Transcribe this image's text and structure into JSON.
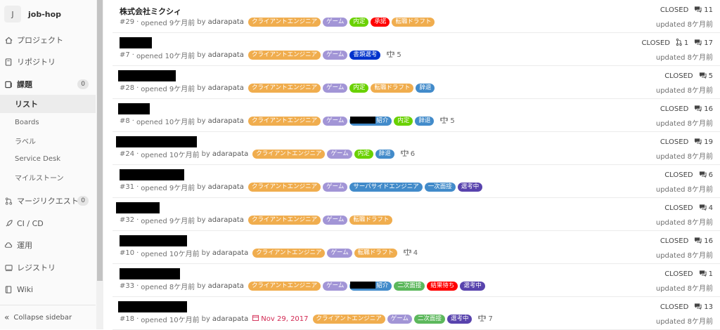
{
  "sidebar": {
    "project_initial": "J",
    "project_name": "job-hop",
    "items": [
      {
        "label": "プロジェクト",
        "icon": "home-icon"
      },
      {
        "label": "リポジトリ",
        "icon": "repository-icon"
      },
      {
        "label": "課題",
        "icon": "issues-icon",
        "count": "0"
      },
      {
        "label": "マージリクエスト",
        "icon": "merge-request-icon",
        "count": "0"
      },
      {
        "label": "CI / CD",
        "icon": "rocket-icon"
      },
      {
        "label": "運用",
        "icon": "cloud-icon"
      },
      {
        "label": "レジストリ",
        "icon": "registry-icon"
      },
      {
        "label": "Wiki",
        "icon": "book-icon"
      }
    ],
    "sub_items": [
      "リスト",
      "Boards",
      "ラベル",
      "Service Desk",
      "マイルストーン"
    ],
    "collapse_label": "Collapse sidebar"
  },
  "colors": {
    "client": "#f0ad4e",
    "game": "#a295d6",
    "naitei": "#69d100",
    "shodaku": "#ff0000",
    "tenshoku": "#f0ad4e",
    "shorui": "#0033cc",
    "jitai": "#428bca",
    "server": "#428bca",
    "ichiji": "#428bca",
    "senkouchu": "#5843ad",
    "shoukai": "#428bca",
    "niji": "#5cb85c",
    "kekka": "#ff0000"
  },
  "issues": [
    {
      "title": "株式会社ミクシィ",
      "ref": "#29",
      "opened": "opened 9ケ月前",
      "by": "by",
      "author": "adarapata",
      "labels": [
        {
          "text": "クライアントエンジニア",
          "c": "client"
        },
        {
          "text": "ゲーム",
          "c": "game"
        },
        {
          "text": "内定",
          "c": "naitei"
        },
        {
          "text": "承諾",
          "c": "shodaku"
        },
        {
          "text": "転職ドラフト",
          "c": "tenshoku"
        }
      ],
      "status": "CLOSED",
      "comments": "11",
      "updated": "updated 8ケ月前"
    },
    {
      "ref": "#7",
      "opened": "opened 10ケ月前",
      "by": "by",
      "author": "adarapata",
      "labels": [
        {
          "text": "クライアントエンジニア",
          "c": "client"
        },
        {
          "text": "ゲーム",
          "c": "game"
        },
        {
          "text": "書類選考",
          "c": "shorui"
        }
      ],
      "weight": "5",
      "status": "CLOSED",
      "mr": "1",
      "comments": "17",
      "updated": "updated 8ケ月前"
    },
    {
      "ref": "#28",
      "opened": "opened 9ケ月前",
      "by": "by",
      "author": "adarapata",
      "labels": [
        {
          "text": "クライアントエンジニア",
          "c": "client"
        },
        {
          "text": "ゲーム",
          "c": "game"
        },
        {
          "text": "内定",
          "c": "naitei"
        },
        {
          "text": "転職ドラフト",
          "c": "tenshoku"
        },
        {
          "text": "辞退",
          "c": "jitai"
        }
      ],
      "status": "CLOSED",
      "comments": "5",
      "updated": "updated 8ケ月前"
    },
    {
      "ref": "#8",
      "opened": "opened 10ケ月前",
      "by": "by",
      "author": "adarapata",
      "labels": [
        {
          "text": "クライアントエンジニア",
          "c": "client"
        },
        {
          "text": "ゲーム",
          "c": "game"
        },
        {
          "text": "紹介",
          "c": "shoukai",
          "redacted": true
        },
        {
          "text": "内定",
          "c": "naitei"
        },
        {
          "text": "辞退",
          "c": "jitai"
        }
      ],
      "weight": "5",
      "status": "CLOSED",
      "comments": "16",
      "updated": "updated 8ケ月前"
    },
    {
      "ref": "#24",
      "opened": "opened 10ケ月前",
      "by": "by",
      "author": "adarapata",
      "labels": [
        {
          "text": "クライアントエンジニア",
          "c": "client"
        },
        {
          "text": "ゲーム",
          "c": "game"
        },
        {
          "text": "内定",
          "c": "naitei"
        },
        {
          "text": "辞退",
          "c": "jitai"
        }
      ],
      "weight": "6",
      "status": "CLOSED",
      "comments": "19",
      "updated": "updated 8ケ月前"
    },
    {
      "ref": "#31",
      "opened": "opened 9ケ月前",
      "by": "by",
      "author": "adarapata",
      "labels": [
        {
          "text": "クライアントエンジニア",
          "c": "client"
        },
        {
          "text": "ゲーム",
          "c": "game"
        },
        {
          "text": "サーバサイドエンジニア",
          "c": "server"
        },
        {
          "text": "一次面接",
          "c": "ichiji"
        },
        {
          "text": "選考中",
          "c": "senkouchu"
        }
      ],
      "status": "CLOSED",
      "comments": "6",
      "updated": "updated 8ケ月前"
    },
    {
      "ref": "#32",
      "opened": "opened 9ケ月前",
      "by": "by",
      "author": "adarapata",
      "labels": [
        {
          "text": "クライアントエンジニア",
          "c": "client"
        },
        {
          "text": "ゲーム",
          "c": "game"
        },
        {
          "text": "転職ドラフト",
          "c": "tenshoku"
        }
      ],
      "status": "CLOSED",
      "comments": "4",
      "updated": "updated 8ケ月前"
    },
    {
      "ref": "#10",
      "opened": "opened 10ケ月前",
      "by": "by",
      "author": "adarapata",
      "labels": [
        {
          "text": "クライアントエンジニア",
          "c": "client"
        },
        {
          "text": "ゲーム",
          "c": "game"
        },
        {
          "text": "転職ドラフト",
          "c": "tenshoku"
        }
      ],
      "weight": "4",
      "status": "CLOSED",
      "comments": "16",
      "updated": "updated 8ケ月前"
    },
    {
      "ref": "#33",
      "opened": "opened 8ケ月前",
      "by": "by",
      "author": "adarapata",
      "labels": [
        {
          "text": "クライアントエンジニア",
          "c": "client"
        },
        {
          "text": "ゲーム",
          "c": "game"
        },
        {
          "text": "紹介",
          "c": "shoukai",
          "redacted": true
        },
        {
          "text": "二次面接",
          "c": "niji"
        },
        {
          "text": "結果待ち",
          "c": "kekka"
        },
        {
          "text": "選考中",
          "c": "senkouchu"
        }
      ],
      "status": "CLOSED",
      "comments": "1",
      "updated": "updated 8ケ月前"
    },
    {
      "ref": "#18",
      "opened": "opened 10ケ月前",
      "by": "by",
      "author": "adarapata",
      "due": "Nov 29, 2017",
      "labels": [
        {
          "text": "クライアントエンジニア",
          "c": "client"
        },
        {
          "text": "ゲーム",
          "c": "game"
        },
        {
          "text": "二次面接",
          "c": "niji"
        },
        {
          "text": "選考中",
          "c": "senkouchu"
        }
      ],
      "weight": "7",
      "status": "CLOSED",
      "comments": "13",
      "updated": "updated 8ケ月前"
    }
  ]
}
